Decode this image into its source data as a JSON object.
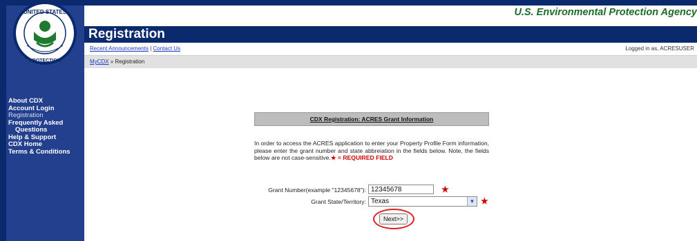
{
  "header": {
    "agency": "U.S. Environmental Protection Agency",
    "page_title": "Registration",
    "logo_text": "UNITED STATES ENVIRONMENTAL PROTECTION AGENCY"
  },
  "top_links": {
    "announcements": "Recent Announcements",
    "separator": "|",
    "contact": "Contact Us",
    "logged_in": "Logged in as, ACRESUSER"
  },
  "breadcrumb": {
    "home": "MyCDX",
    "separator": "»",
    "current": "Registration"
  },
  "sidebar": {
    "items": [
      {
        "label": "About CDX"
      },
      {
        "label": "Account Login"
      },
      {
        "label": "Registration"
      },
      {
        "label": "Frequently Asked"
      },
      {
        "label": "Questions"
      },
      {
        "label": "Help & Support"
      },
      {
        "label": "CDX Home"
      },
      {
        "label": "Terms & Conditions"
      }
    ]
  },
  "panel": {
    "heading": "CDX Registration: ACRES Grant Information",
    "intro": "In order to access the ACRES application to enter your Property Profile Form information, please enter the grant number and state abbreiation in the fields below. Note, the fields below are not case-sensitive.",
    "required_star": "★",
    "required_note": " = REQUIRED FIELD"
  },
  "form": {
    "grant_number_label": "Grant Number(example \"12345678\"):",
    "grant_number_value": "12345678",
    "state_label": "Grant State/Territory:",
    "state_value": "Texas",
    "required_marker": "★",
    "next_button": "Next>>"
  },
  "colors": {
    "navy": "#0b2a6e",
    "sidebar": "#23408e",
    "agency_green": "#1e6a2a",
    "required_red": "#d00000",
    "highlight_ring": "#e11d1d"
  }
}
